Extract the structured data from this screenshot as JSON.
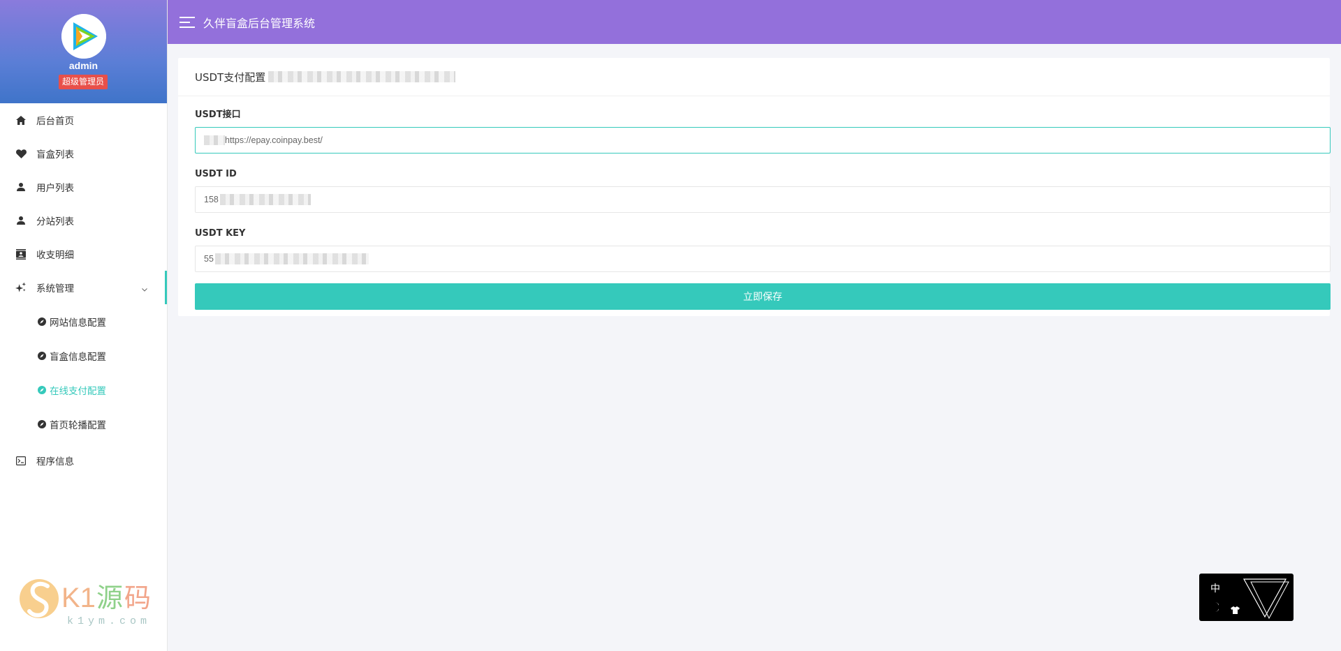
{
  "app": {
    "title": "久伴盲盒后台管理系统"
  },
  "profile": {
    "username": "admin",
    "role": "超级管理员"
  },
  "sidebar": {
    "items": [
      {
        "label": "后台首页",
        "icon": "home-icon"
      },
      {
        "label": "盲盒列表",
        "icon": "heart-icon"
      },
      {
        "label": "用户列表",
        "icon": "user-icon"
      },
      {
        "label": "分站列表",
        "icon": "user-icon"
      },
      {
        "label": "收支明细",
        "icon": "contacts-icon"
      },
      {
        "label": "系统管理",
        "icon": "sparkle-icon"
      }
    ],
    "submenu": [
      {
        "label": "网站信息配置",
        "icon": "compass-icon"
      },
      {
        "label": "盲盒信息配置",
        "icon": "compass-icon"
      },
      {
        "label": "在线支付配置",
        "icon": "compass-icon",
        "active": true
      },
      {
        "label": "首页轮播配置",
        "icon": "compass-icon"
      }
    ],
    "last_item": {
      "label": "程序信息",
      "icon": "terminal-icon"
    }
  },
  "card": {
    "title": "USDT支付配置",
    "fields": [
      {
        "label": "USDT接口",
        "value": "https://epay.coinpay.best/"
      },
      {
        "label": "USDT ID",
        "value": "158"
      },
      {
        "label": "USDT KEY",
        "value": "55"
      }
    ],
    "save_label": "立即保存"
  },
  "widget": {
    "lang": "中"
  },
  "watermark": {
    "brand": "K1源码",
    "domain": "k1ym.com"
  },
  "colors": {
    "topbar": "#9370db",
    "accent": "#35c9bb",
    "badge": "#e8504a"
  }
}
